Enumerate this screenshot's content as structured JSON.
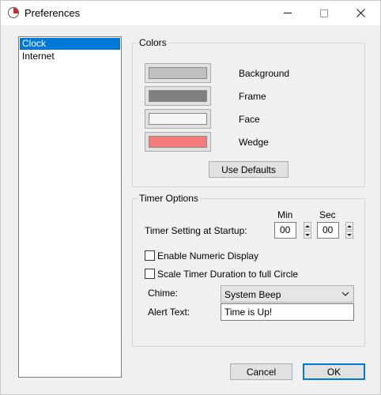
{
  "window": {
    "title": "Preferences"
  },
  "categories": [
    {
      "label": "Clock",
      "selected": true
    },
    {
      "label": "Internet",
      "selected": false
    }
  ],
  "colors_group": {
    "label": "Colors",
    "swatches": [
      {
        "label": "Background",
        "color": "#c0c0c0"
      },
      {
        "label": "Frame",
        "color": "#808080"
      },
      {
        "label": "Face",
        "color": "#f5f5f5"
      },
      {
        "label": "Wedge",
        "color": "#f57a7a"
      }
    ],
    "use_defaults_label": "Use Defaults"
  },
  "timer_group": {
    "label": "Timer Options",
    "min_header": "Min",
    "sec_header": "Sec",
    "startup_label": "Timer Setting at Startup:",
    "min_value": "00",
    "sec_value": "00",
    "numeric_display_label": "Enable Numeric Display",
    "numeric_display_checked": false,
    "scale_label": "Scale Timer Duration to full Circle",
    "scale_checked": false,
    "chime_label": "Chime:",
    "chime_value": "System Beep",
    "alert_label": "Alert Text:",
    "alert_value": "Time is Up!"
  },
  "footer": {
    "cancel_label": "Cancel",
    "ok_label": "OK"
  }
}
